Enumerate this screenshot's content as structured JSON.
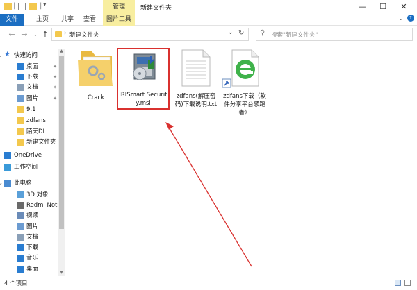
{
  "window": {
    "title": "新建文件夹",
    "context_tab": "管理",
    "controls": [
      "—",
      "☐",
      "✕"
    ]
  },
  "ribbon": {
    "tabs": [
      "文件",
      "主页",
      "共享",
      "查看",
      "图片工具"
    ]
  },
  "address": {
    "path": "新建文件夹",
    "search_placeholder": "搜索\"新建文件夹\""
  },
  "sidebar": {
    "items": [
      {
        "label": "快速访问",
        "icon": "star-icon",
        "pinned": false
      },
      {
        "label": "桌面",
        "icon": "desktop-icon",
        "pinned": true
      },
      {
        "label": "下载",
        "icon": "download-icon",
        "pinned": true
      },
      {
        "label": "文档",
        "icon": "documents-icon",
        "pinned": true
      },
      {
        "label": "图片",
        "icon": "pictures-icon",
        "pinned": true
      },
      {
        "label": "9.1",
        "icon": "folder-icon",
        "pinned": false
      },
      {
        "label": "zdfans",
        "icon": "folder-icon",
        "pinned": false
      },
      {
        "label": "陌天DLL",
        "icon": "folder-icon",
        "pinned": false
      },
      {
        "label": "新建文件夹",
        "icon": "folder-icon",
        "pinned": false
      },
      {
        "label": "OneDrive",
        "icon": "cloud-icon",
        "pinned": false
      },
      {
        "label": "工作空间",
        "icon": "workspace-icon",
        "pinned": false
      },
      {
        "label": "此电脑",
        "icon": "computer-icon",
        "pinned": false
      },
      {
        "label": "3D 对象",
        "icon": "3d-objects-icon",
        "pinned": false
      },
      {
        "label": "Redmi Note",
        "icon": "phone-icon",
        "pinned": false
      },
      {
        "label": "视频",
        "icon": "video-icon",
        "pinned": false
      },
      {
        "label": "图片",
        "icon": "pictures-icon",
        "pinned": false
      },
      {
        "label": "文档",
        "icon": "documents-icon",
        "pinned": false
      },
      {
        "label": "下载",
        "icon": "download-icon",
        "pinned": false
      },
      {
        "label": "音乐",
        "icon": "music-icon",
        "pinned": false
      },
      {
        "label": "桌面",
        "icon": "desktop-icon",
        "pinned": false
      }
    ]
  },
  "files": [
    {
      "name": "Crack",
      "icon": "folder-icon"
    },
    {
      "name": "IRISmart Security.msi",
      "icon": "msi-installer-icon",
      "highlighted": true
    },
    {
      "name": "zdfans(解压密码)下载说明.txt",
      "icon": "text-file-icon"
    },
    {
      "name": "zdfans下载（软件分享平台领跑者）",
      "icon": "ie-shortcut-icon"
    }
  ],
  "status": {
    "count": "4 个项目"
  },
  "colors": {
    "accent": "#1b6ec2",
    "context_tab": "#f8eea0",
    "highlight": "#d9312f"
  }
}
